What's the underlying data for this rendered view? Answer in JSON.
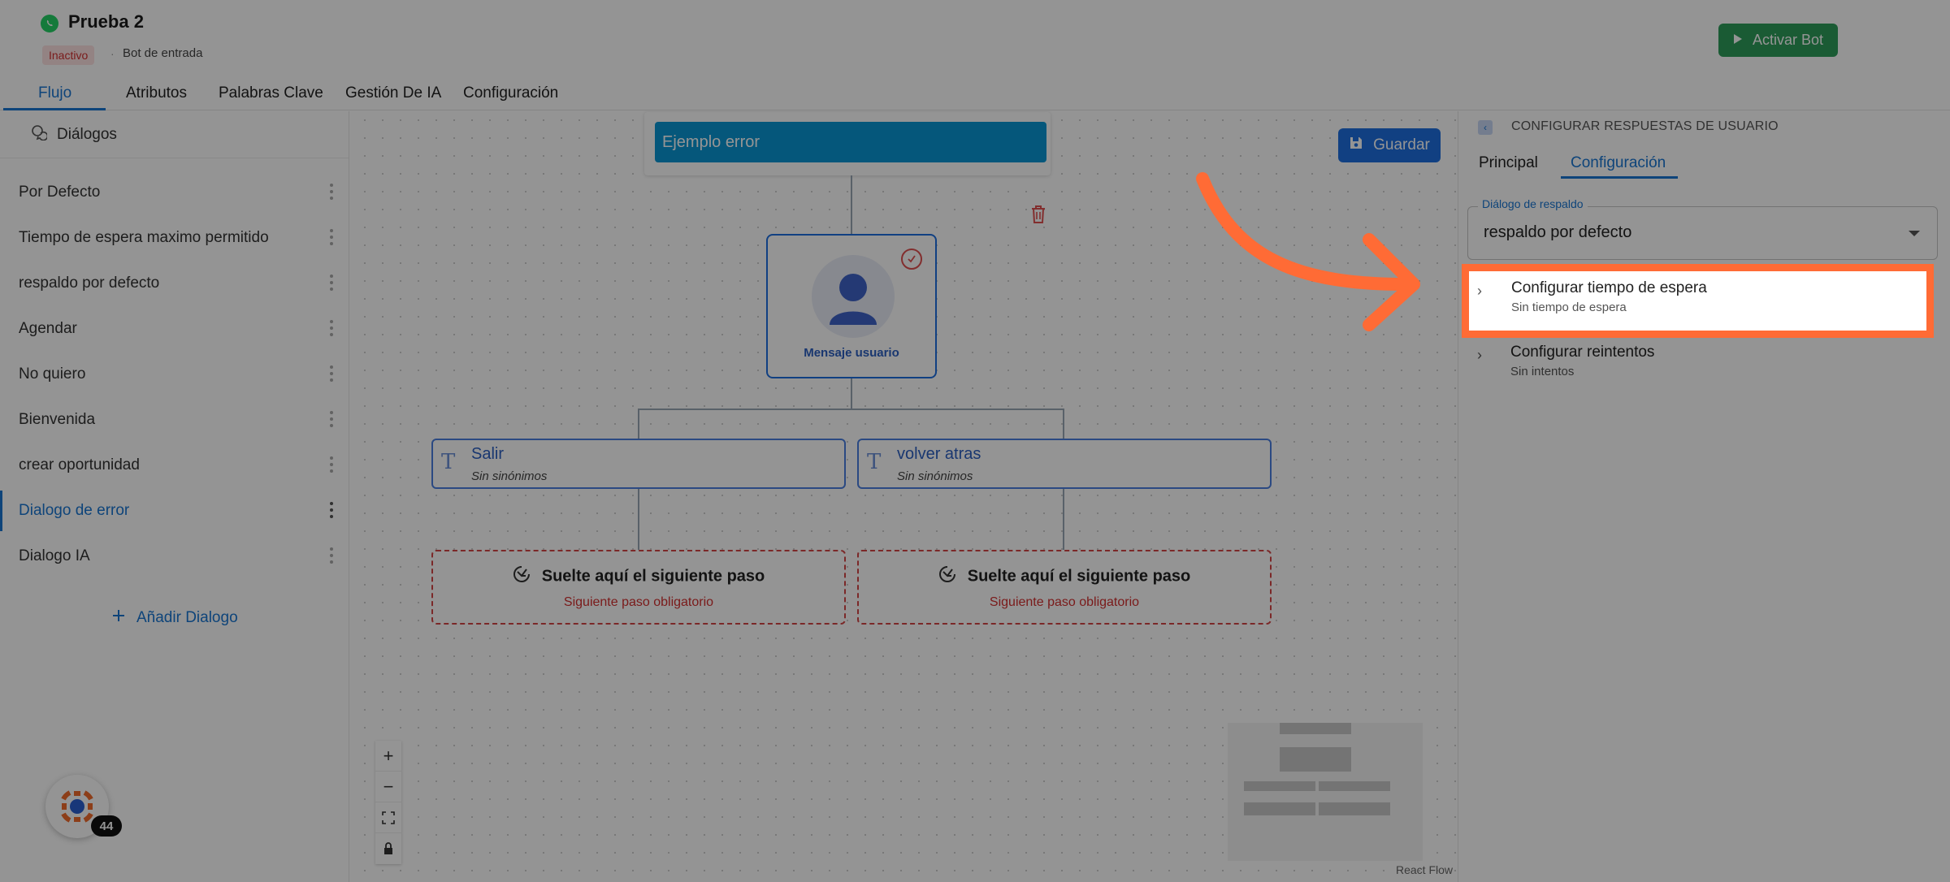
{
  "header": {
    "bot_name": "Prueba 2",
    "status_badge": "Inactivo",
    "separator": "·",
    "bot_type": "Bot de entrada",
    "activate_button": "Activar Bot"
  },
  "tabs": [
    {
      "label": "Flujo",
      "active": true
    },
    {
      "label": "Atributos",
      "active": false
    },
    {
      "label": "Palabras Clave",
      "active": false
    },
    {
      "label": "Gestión De IA",
      "active": false
    },
    {
      "label": "Configuración",
      "active": false
    }
  ],
  "sidebar": {
    "heading": "Diálogos",
    "items": [
      {
        "label": "Por Defecto",
        "active": false
      },
      {
        "label": "Tiempo de espera maximo permitido",
        "active": false
      },
      {
        "label": "respaldo por defecto",
        "active": false
      },
      {
        "label": "Agendar",
        "active": false
      },
      {
        "label": "No quiero",
        "active": false
      },
      {
        "label": "Bienvenida",
        "active": false
      },
      {
        "label": "crear oportunidad",
        "active": false
      },
      {
        "label": "Dialogo de error",
        "active": true
      },
      {
        "label": "Dialogo IA",
        "active": false
      }
    ],
    "add_button": "Añadir Dialogo"
  },
  "canvas": {
    "save_button": "Guardar",
    "title_node": "Ejemplo error",
    "user_node_label": "Mensaje usuario",
    "options": [
      {
        "title": "Salir",
        "subtitle": "Sin sinónimos"
      },
      {
        "title": "volver atras",
        "subtitle": "Sin sinónimos"
      }
    ],
    "drop_zones": [
      {
        "title": "Suelte aquí el siguiente paso",
        "subtitle": "Siguiente paso obligatorio"
      },
      {
        "title": "Suelte aquí el siguiente paso",
        "subtitle": "Siguiente paso obligatorio"
      }
    ],
    "zoom_controls": [
      "+",
      "−"
    ],
    "attribution": "React Flow",
    "helper_count": "44"
  },
  "right_panel": {
    "title": "CONFIGURAR RESPUESTAS DE USUARIO",
    "tabs": [
      {
        "label": "Principal",
        "active": false
      },
      {
        "label": "Configuración",
        "active": true
      }
    ],
    "fallback_select": {
      "label": "Diálogo de respaldo",
      "value": "respaldo por defecto"
    },
    "config_rows": [
      {
        "title": "Configurar tiempo de espera",
        "subtitle": "Sin tiempo de espera",
        "highlighted": true
      },
      {
        "title": "Configurar reintentos",
        "subtitle": "Sin intentos",
        "highlighted": false
      }
    ]
  },
  "colors": {
    "accent": "#1976d2",
    "highlight": "#ff6b35",
    "activate": "#2e9e5b",
    "title_node": "#0a96d4",
    "danger": "#d32f2f"
  },
  "icons": {
    "whatsapp": "whatsapp-icon",
    "play": "play-icon",
    "chat": "chat-icon",
    "plus": "plus-icon",
    "save": "save-icon",
    "trash": "trash-icon",
    "user": "user-avatar-icon",
    "text": "text-T-icon",
    "drop": "drop-target-icon",
    "chevron": "chevron-right-icon",
    "arrow": "curved-arrow-annotation"
  }
}
